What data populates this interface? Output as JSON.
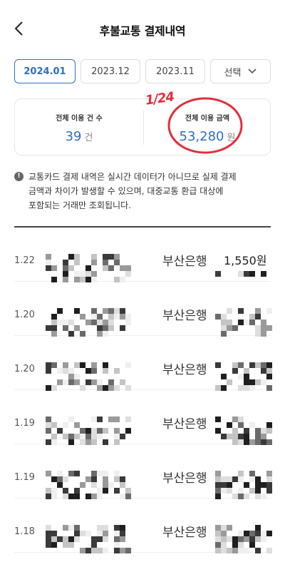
{
  "header": {
    "title": "후불교통 결제내역",
    "back_icon": "chevron-left-icon"
  },
  "tabs": [
    {
      "label": "2024.01",
      "active": true
    },
    {
      "label": "2023.12",
      "active": false
    },
    {
      "label": "2023.11",
      "active": false
    },
    {
      "label": "선택",
      "active": false
    }
  ],
  "summary": {
    "count_label": "전체 이용 건 수",
    "count_value": "39",
    "count_unit": "건",
    "amount_label": "전체 이용 금액",
    "amount_value": "53,280",
    "amount_unit": "원"
  },
  "annotation": {
    "text": "1/24",
    "color": "#e0303c"
  },
  "notice": {
    "icon": "exclamation-circle-icon",
    "line1": "교통카드 결제 내역은 실시간 데이터가 아니므로 실제 결제",
    "line2": "금액과 차이가 발생할 수 있으며, 대중교통 환급 대상에",
    "line3": "포함되는 거래만 조회됩니다."
  },
  "transactions": [
    {
      "date": "1.22",
      "bank": "부산은행",
      "amount": "1,550원"
    },
    {
      "date": "1.20",
      "bank": "부산은행",
      "amount": ""
    },
    {
      "date": "1.20",
      "bank": "부산은행",
      "amount": ""
    },
    {
      "date": "1.19",
      "bank": "부산은행",
      "amount": ""
    },
    {
      "date": "1.19",
      "bank": "부산은행",
      "amount": ""
    },
    {
      "date": "1.18",
      "bank": "부산은행",
      "amount": ""
    }
  ],
  "colors": {
    "accent": "#2e6fbf",
    "annotation": "#e0303c"
  }
}
